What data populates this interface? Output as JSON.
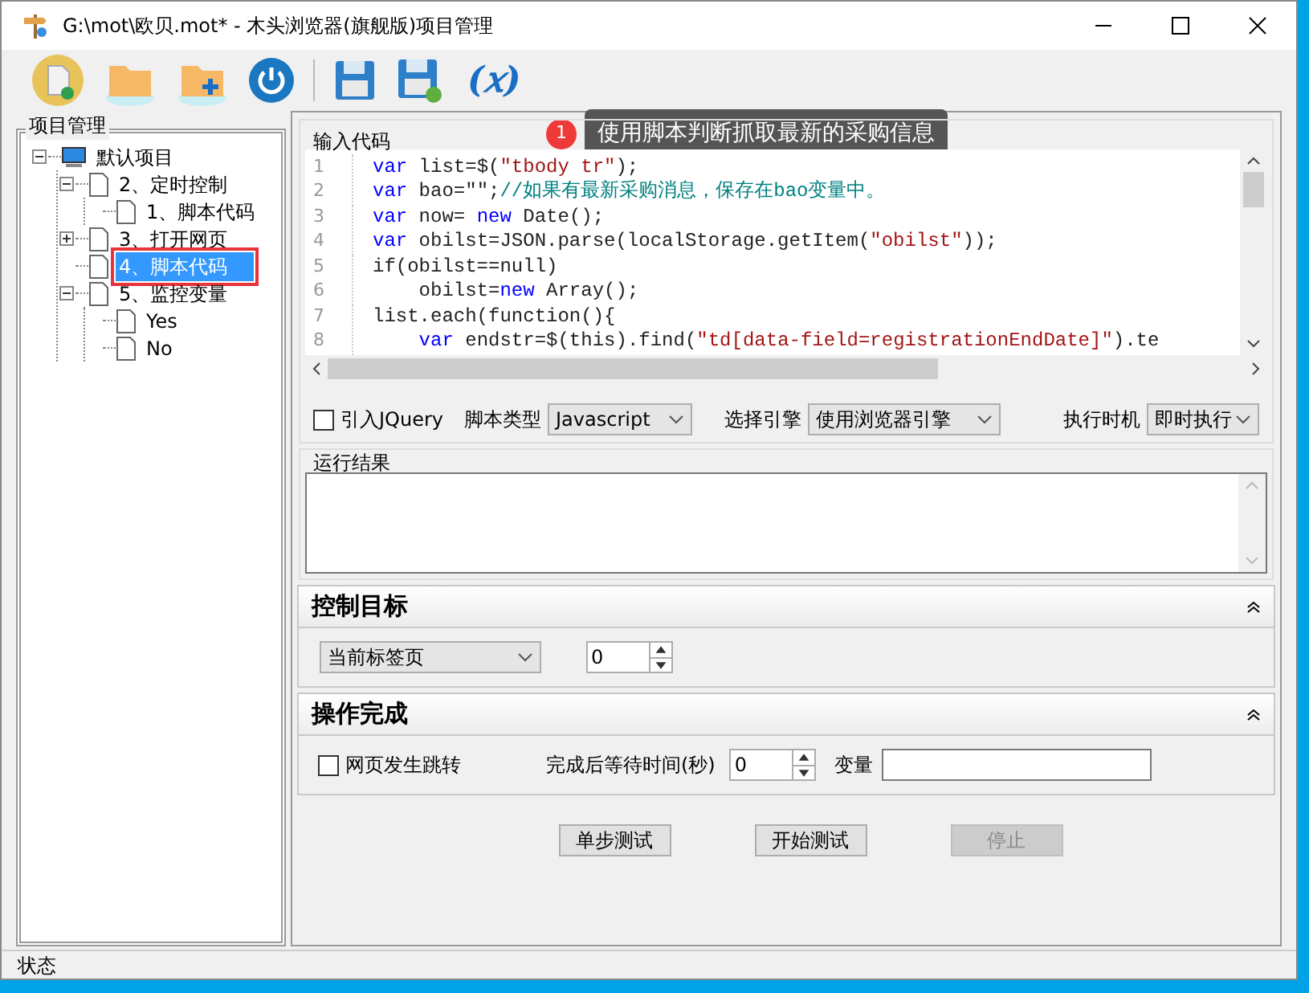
{
  "window": {
    "title": "G:\\mot\\欧贝.mot* - 木头浏览器(旗舰版)项目管理"
  },
  "toolbar": [
    {
      "kind": "new"
    },
    {
      "kind": "open"
    },
    {
      "kind": "add"
    },
    {
      "kind": "power"
    },
    {
      "kind": "save"
    },
    {
      "kind": "saveas"
    },
    {
      "kind": "var",
      "text": "(𝑥)"
    }
  ],
  "project_panel": {
    "title": "项目管理",
    "tree": [
      {
        "label": "默认项目",
        "kind": "computer",
        "expanded": true,
        "selected": false,
        "children": [
          {
            "label": "2、定时控制",
            "kind": "file",
            "expanded": true,
            "selected": false,
            "children": [
              {
                "label": "1、脚本代码",
                "kind": "file",
                "selected": false
              }
            ]
          },
          {
            "label": "3、打开网页",
            "kind": "file",
            "expanded": false,
            "selected": false
          },
          {
            "label": "4、脚本代码",
            "kind": "file",
            "selected": true,
            "highlighted": true
          },
          {
            "label": "5、监控变量",
            "kind": "file",
            "expanded": true,
            "selected": false,
            "children": [
              {
                "label": "Yes",
                "kind": "file",
                "selected": false
              },
              {
                "label": "No",
                "kind": "file",
                "selected": false
              }
            ]
          }
        ]
      }
    ]
  },
  "callout": {
    "badge": "1",
    "text": "使用脚本判断抓取最新的采购信息"
  },
  "code_group": {
    "title": "输入代码",
    "lines": [
      {
        "number": "1",
        "tokens": [
          {
            "kind": "keyword",
            "text": "var"
          },
          {
            "kind": "plain",
            "text": " list=$("
          },
          {
            "kind": "string",
            "text": "\"tbody tr\""
          },
          {
            "kind": "plain",
            "text": ");"
          }
        ]
      },
      {
        "number": "2",
        "tokens": [
          {
            "kind": "keyword",
            "text": "var"
          },
          {
            "kind": "plain",
            "text": " bao=\"\";"
          },
          {
            "kind": "comment",
            "text": "//如果有最新采购消息，保存在bao变量中。"
          }
        ]
      },
      {
        "number": "3",
        "tokens": [
          {
            "kind": "keyword",
            "text": "var"
          },
          {
            "kind": "plain",
            "text": " now= "
          },
          {
            "kind": "keyword",
            "text": "new"
          },
          {
            "kind": "plain",
            "text": " Date();"
          }
        ]
      },
      {
        "number": "4",
        "tokens": [
          {
            "kind": "keyword",
            "text": "var"
          },
          {
            "kind": "plain",
            "text": " obilst=JSON.parse(localStorage.getItem("
          },
          {
            "kind": "string",
            "text": "\"obilst\""
          },
          {
            "kind": "plain",
            "text": "));"
          }
        ]
      },
      {
        "number": "5",
        "tokens": [
          {
            "kind": "plain",
            "text": "if(obilst==null)"
          }
        ]
      },
      {
        "number": "6",
        "tokens": [
          {
            "kind": "plain",
            "text": "    obilst="
          },
          {
            "kind": "keyword",
            "text": "new"
          },
          {
            "kind": "plain",
            "text": " Array();"
          }
        ]
      },
      {
        "number": "7",
        "tokens": [
          {
            "kind": "plain",
            "text": "list.each(function(){"
          }
        ]
      },
      {
        "number": "8",
        "tokens": [
          {
            "kind": "keyword",
            "text": "    var"
          },
          {
            "kind": "plain",
            "text": " endstr=$(this).find("
          },
          {
            "kind": "string",
            "text": "\"td[data-field=registrationEndDate]\""
          },
          {
            "kind": "plain",
            "text": ").te"
          }
        ]
      }
    ],
    "jquery": {
      "label": "引入JQuery",
      "checked": false
    },
    "script_type": {
      "label": "脚本类型",
      "value": "Javascript"
    },
    "engine": {
      "label": "选择引擎",
      "value": "使用浏览器引擎"
    },
    "timing": {
      "label": "执行时机",
      "value": "即时执行"
    }
  },
  "result_group": {
    "title": "运行结果"
  },
  "control_target": {
    "title": "控制目标",
    "tab_select": {
      "value": "当前标签页"
    },
    "index": {
      "value": "0"
    }
  },
  "done": {
    "title": "操作完成",
    "redirect": {
      "label": "网页发生跳转",
      "checked": false
    },
    "wait": {
      "label": "完成后等待时间(秒)",
      "value": "0"
    },
    "variable": {
      "label": "变量"
    }
  },
  "buttons": [
    {
      "label": "单步测试",
      "disabled": false
    },
    {
      "label": "开始测试",
      "disabled": false
    },
    {
      "label": "停止",
      "disabled": true
    }
  ],
  "status_bar": {
    "text": "状态"
  }
}
